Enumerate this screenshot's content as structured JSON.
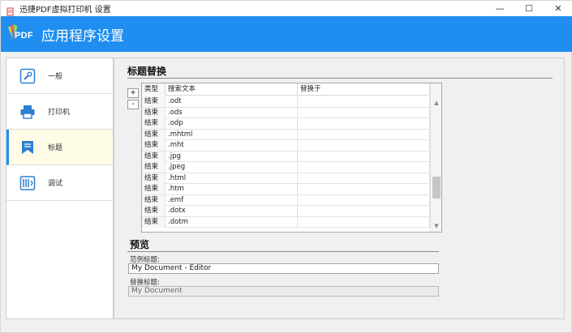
{
  "window": {
    "title": "迅捷PDF虚拟打印机 设置",
    "controls": {
      "minimize": "—",
      "maximize": "☐",
      "close": "✕"
    }
  },
  "header": {
    "logo_text": "PDF",
    "title": "应用程序设置",
    "background": "#1f8ef0"
  },
  "sidebar": {
    "items": [
      {
        "label": "一般",
        "icon": "wrench-icon"
      },
      {
        "label": "打印机",
        "icon": "printer-icon"
      },
      {
        "label": "标题",
        "icon": "bookmark-icon",
        "active": true
      },
      {
        "label": "调试",
        "icon": "debug-icon"
      }
    ]
  },
  "title_replace": {
    "section_title": "标题替换",
    "add_label": "+",
    "remove_label": "-",
    "columns": [
      "类型",
      "搜索文本",
      "替换于"
    ],
    "rows": [
      {
        "type": "结束",
        "search": ".odt",
        "replace": ""
      },
      {
        "type": "结束",
        "search": ".ods",
        "replace": ""
      },
      {
        "type": "结束",
        "search": ".odp",
        "replace": ""
      },
      {
        "type": "结束",
        "search": ".mhtml",
        "replace": ""
      },
      {
        "type": "结束",
        "search": ".mht",
        "replace": ""
      },
      {
        "type": "结束",
        "search": ".jpg",
        "replace": ""
      },
      {
        "type": "结束",
        "search": ".jpeg",
        "replace": ""
      },
      {
        "type": "结束",
        "search": ".html",
        "replace": ""
      },
      {
        "type": "结束",
        "search": ".htm",
        "replace": ""
      },
      {
        "type": "结束",
        "search": ".emf",
        "replace": ""
      },
      {
        "type": "结束",
        "search": ".dotx",
        "replace": ""
      },
      {
        "type": "结束",
        "search": ".dotm",
        "replace": ""
      }
    ]
  },
  "preview": {
    "section_title": "预览",
    "sample_label": "范例标题:",
    "sample_value": "My Document - Editor",
    "replaced_label": "替换标题:",
    "replaced_value": "My Document"
  }
}
